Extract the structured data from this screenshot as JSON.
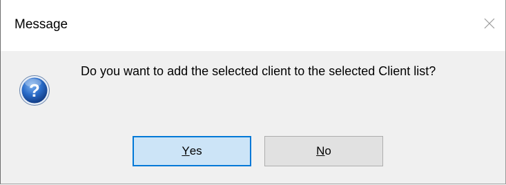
{
  "window": {
    "title": "Message",
    "close_icon": "close-icon"
  },
  "message": {
    "icon": "question-icon",
    "icon_glyph": "?",
    "text": "Do you want to add the selected client to the selected Client list?"
  },
  "buttons": {
    "yes": {
      "mnemonic": "Y",
      "rest": "es",
      "default": true
    },
    "no": {
      "mnemonic": "N",
      "rest": "o",
      "default": false
    }
  },
  "colors": {
    "default_button_bg": "#cce4f7",
    "default_button_border": "#0078d7",
    "button_bg": "#e1e1e1",
    "icon_blue": "#1f5fb8"
  }
}
